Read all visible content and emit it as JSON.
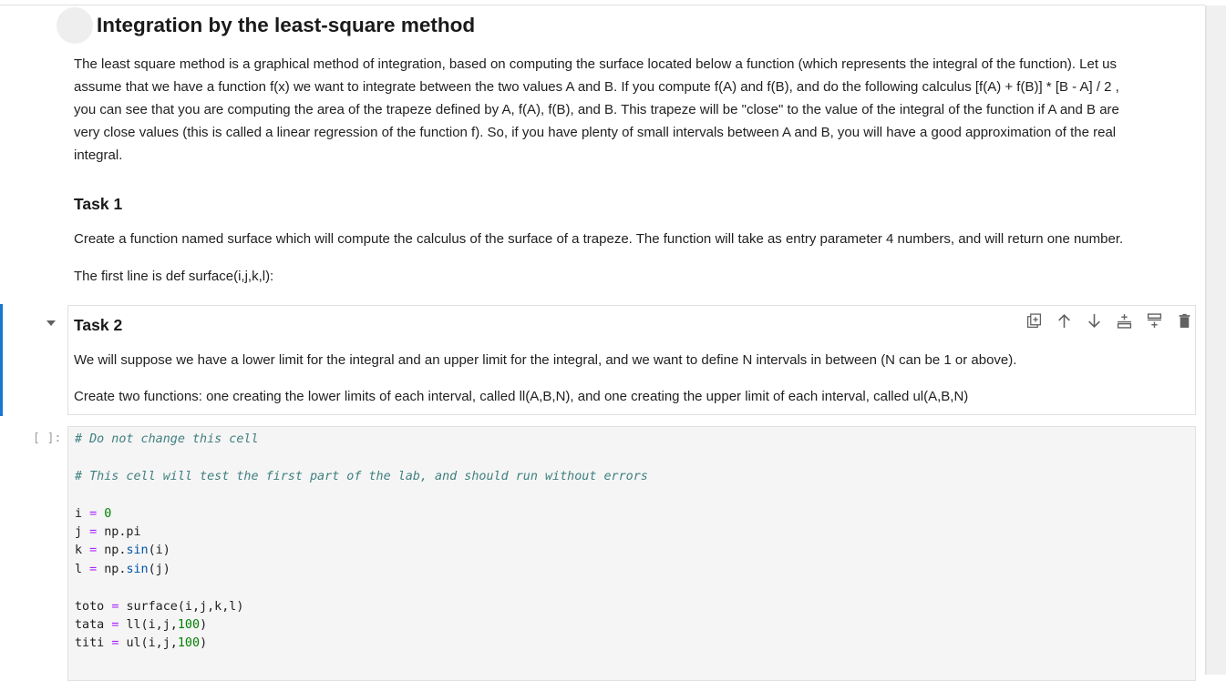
{
  "header": {
    "title": "Integration by the least-square method"
  },
  "intro": {
    "paragraph_lines": [
      "The least square method is a graphical method of integration, based on computing the surface located below a function (which represents the integral of the function). Let us",
      "assume that we have a function f(x) we want to integrate between the two values A and B. If you compute f(A) and f(B), and do the following calculus [f(A) + f(B)] * [B - A] / 2 ,",
      "you can see that you are computing the area of the trapeze defined by A, f(A), f(B), and B. This trapeze will be \"close\" to the value of the integral of the function if A and B are",
      "very close values (this is called a linear regression of the function f). So, if you have plenty of small intervals between A and B, you will have a good approximation of the real",
      "integral."
    ]
  },
  "task1": {
    "heading": "Task 1",
    "description": "Create a function named surface which will compute the calculus of the surface of a trapeze. The function will take as entry parameter 4 numbers, and will return one number.",
    "first_line": "The first line is def surface(i,j,k,l):"
  },
  "task2": {
    "heading": "Task 2",
    "description": "We will suppose we have a lower limit for the integral and an upper limit for the integral, and we want to define N intervals in between (N can be 1 or above).",
    "instruction": "Create two functions: one creating the lower limits of each interval, called ll(A,B,N), and one creating the upper limit of each interval, called ul(A,B,N)"
  },
  "cell_toolbar": {
    "icons": [
      "duplicate-icon",
      "move-up-icon",
      "move-down-icon",
      "insert-above-icon",
      "insert-below-icon",
      "delete-icon"
    ]
  },
  "code_cell": {
    "prompt": "[ ]:",
    "comment1": "# Do not change this cell",
    "comment2": "# This cell will test the first part of the lab, and should run without errors",
    "lines": {
      "i_var": "i",
      "i_val": "0",
      "j_var": "j",
      "j_val": "np.pi",
      "k_var": "k",
      "k_mod": "np.",
      "k_fn": "sin",
      "k_arg": "(i)",
      "l_var": "l",
      "l_mod": "np.",
      "l_fn": "sin",
      "l_arg": "(j)",
      "toto_var": "toto",
      "toto_val": "surface(i,j,k,l)",
      "tata_var": "tata",
      "tata_call": "ll(i,j,",
      "tata_num": "100",
      "tata_end": ")",
      "titi_var": "titi",
      "titi_call": "ul(i,j,",
      "titi_num": "100",
      "titi_end": ")"
    }
  }
}
